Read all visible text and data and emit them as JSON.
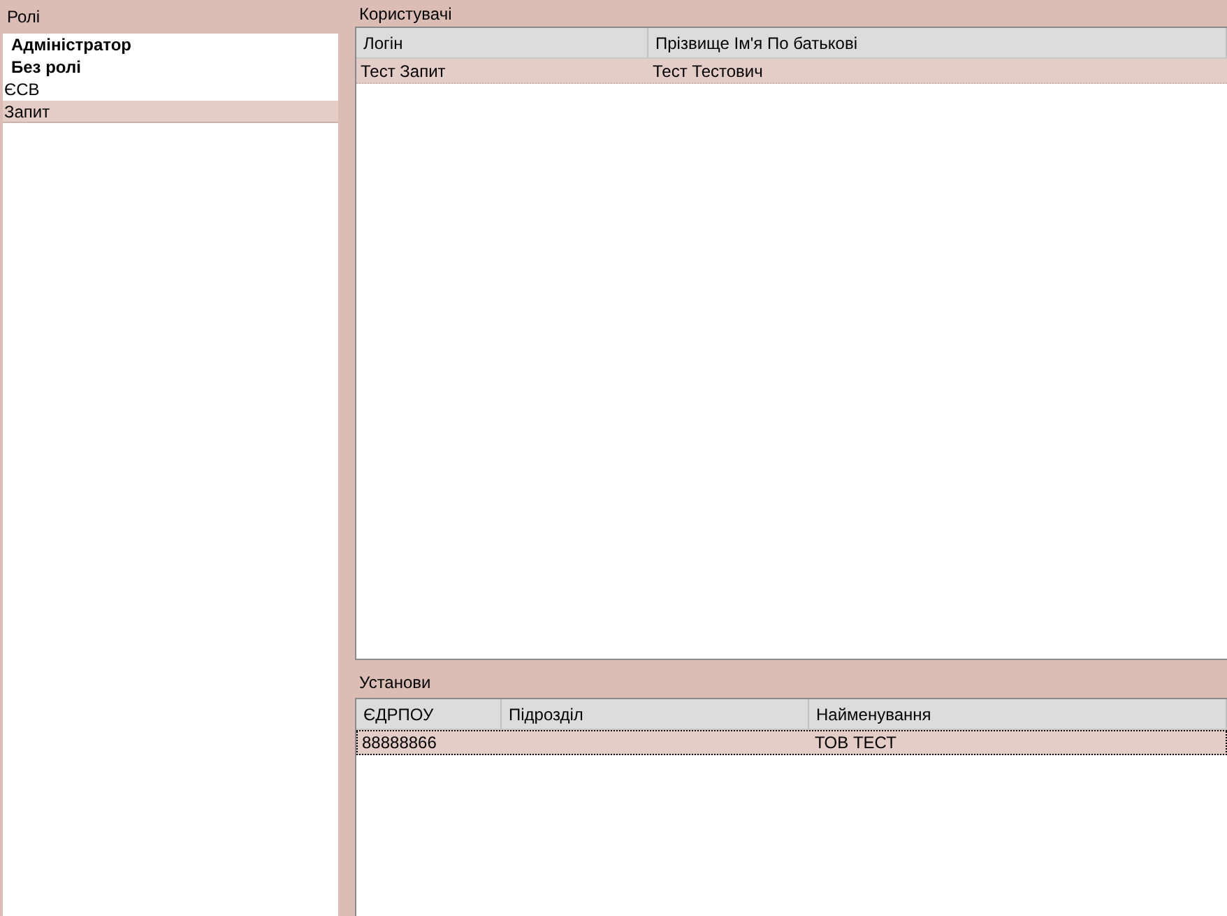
{
  "roles": {
    "title": "Ролі",
    "items": [
      {
        "label": "Адміністратор",
        "bold": true,
        "selected": false
      },
      {
        "label": "Без ролі",
        "bold": true,
        "selected": false
      },
      {
        "label": "ЄСВ",
        "bold": false,
        "selected": false
      },
      {
        "label": "Запит",
        "bold": false,
        "selected": true
      }
    ]
  },
  "users": {
    "title": "Користувачі",
    "columns": [
      "Логін",
      "Прізвище Ім'я По батькові"
    ],
    "rows": [
      {
        "cells": [
          "Тест Запит",
          "Тест Тестович"
        ],
        "selected": true,
        "focused": false
      }
    ]
  },
  "institutions": {
    "title": "Установи",
    "columns": [
      "ЄДРПОУ",
      "Підрозділ",
      "Найменування"
    ],
    "rows": [
      {
        "cells": [
          "88888866",
          "",
          "ТОВ ТЕСТ"
        ],
        "selected": true,
        "focused": true
      }
    ]
  }
}
